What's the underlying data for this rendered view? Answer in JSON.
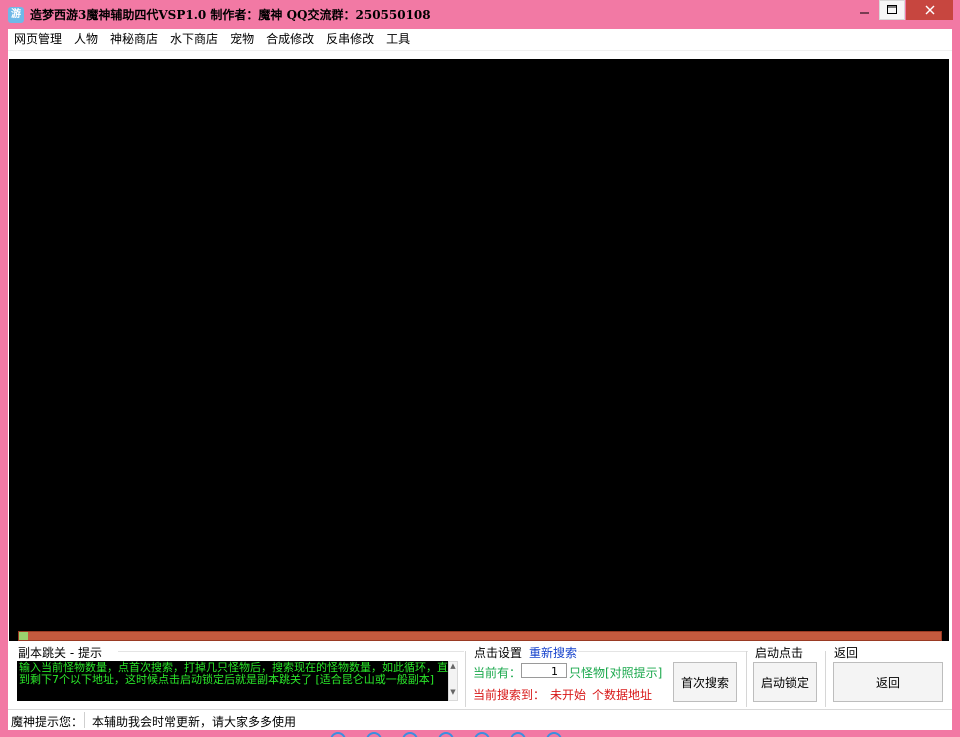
{
  "window": {
    "title": "造梦西游3魔神辅助四代VSP1.0  制作者：魔神   QQ交流群：250550108",
    "icon_label": "游"
  },
  "menu": [
    "网页管理",
    "人物",
    "神秘商店",
    "水下商店",
    "宠物",
    "合成修改",
    "反串修改",
    "工具"
  ],
  "progress": {
    "value": 0.01
  },
  "sections": {
    "jump": {
      "title": "副本跳关 - 提示",
      "tip": "输入当前怪物数量，点首次搜索，打掉几只怪物后，搜索现在的怪物数量，如此循环，直到剩下7个以下地址，这时候点击启动锁定后就是副本跳关了 [适合昆仑山或一般副本]"
    },
    "click": {
      "title": "点击设置",
      "research": "重新搜索",
      "current_label": "当前有：",
      "count_value": "1",
      "monster_label": "只怪物[对照提示]",
      "found_label": "当前搜索到：",
      "found_value": "未开始",
      "found_suffix": "个数据地址",
      "first_search": "首次搜索"
    },
    "start": {
      "title": "启动点击",
      "lock": "启动锁定"
    },
    "back": {
      "title": "返回",
      "button": "返回"
    }
  },
  "status": {
    "label": "魔神提示您：",
    "message": "本辅助我会时常更新，请大家多多使用"
  },
  "colors": {
    "frame": "#f279a4",
    "close": "#c7463f",
    "tip_text": "#2ae82a",
    "progress_bg": "#c45a3e",
    "progress_fill": "#9bd16e"
  }
}
